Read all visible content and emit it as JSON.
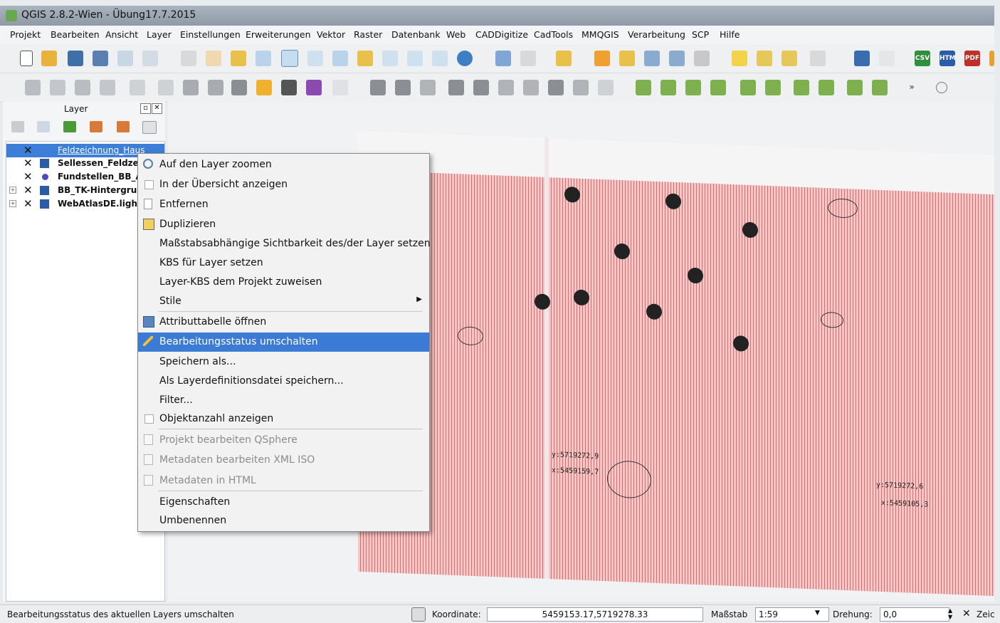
{
  "window": {
    "title": "QGIS 2.8.2-Wien - Übung17.7.2015"
  },
  "menubar": [
    "Projekt",
    "Bearbeiten",
    "Ansicht",
    "Layer",
    "Einstellungen",
    "Erweiterungen",
    "Vektor",
    "Raster",
    "Datenbank",
    "Web",
    "CADDigitize",
    "CadTools",
    "MMQGIS",
    "Verarbeitung",
    "SCP",
    "Hilfe"
  ],
  "toolbar_labels": {
    "csv": "CSV",
    "htm": "HTM",
    "pdf": "PDF"
  },
  "layer_panel": {
    "title": "Layer",
    "layers": [
      {
        "name": "Feldzeichnung_Haus",
        "checked": "✕",
        "selected": true
      },
      {
        "name": "Sellessen_Feldzei",
        "checked": "✕"
      },
      {
        "name": "Fundstellen_BB_A",
        "checked": "✕"
      },
      {
        "name": "BB_TK-Hintergrur",
        "checked": "✕"
      },
      {
        "name": "WebAtlasDE.light",
        "checked": "✕"
      }
    ]
  },
  "context_menu": {
    "items": [
      {
        "label": "Auf den Layer zoomen",
        "icon": "zoom-layer-icon"
      },
      {
        "label": "In der Übersicht anzeigen",
        "icon": "checkbox-icon"
      },
      {
        "label": "Entfernen",
        "icon": "remove-layer-icon"
      },
      {
        "label": "Duplizieren",
        "icon": "duplicate-icon"
      },
      {
        "label": "Maßstabsabhängige Sichtbarkeit des/der Layer setzen"
      },
      {
        "label": "KBS für Layer setzen"
      },
      {
        "label": "Layer-KBS dem Projekt zuweisen"
      },
      {
        "label": "Stile",
        "submenu": true
      },
      {
        "label": "Attributtabelle öffnen",
        "icon": "table-icon"
      },
      {
        "label": "Bearbeitungsstatus umschalten",
        "icon": "pencil-icon",
        "highlighted": true
      },
      {
        "label": "Speichern als..."
      },
      {
        "label": "Als Layerdefinitionsdatei speichern..."
      },
      {
        "label": "Filter..."
      },
      {
        "label": "Objektanzahl anzeigen",
        "icon": "checkbox-icon"
      },
      {
        "label": "Projekt bearbeiten QSphere",
        "disabled": true,
        "icon": "doc-icon"
      },
      {
        "label": "Metadaten bearbeiten XML ISO",
        "disabled": true,
        "icon": "doc-icon"
      },
      {
        "label": "Metadaten in HTML",
        "disabled": true,
        "icon": "doc-icon"
      },
      {
        "label": "Eigenschaften"
      },
      {
        "label": "Umbenennen"
      }
    ]
  },
  "map": {
    "annotations": [
      "y:5719272,9",
      "x:5459159,7",
      "y:5719272,6",
      "x:5459105,3"
    ]
  },
  "statusbar": {
    "message": "Bearbeitungsstatus des aktuellen Layers umschalten",
    "coord_label": "Koordinate:",
    "coord_value": "5459153.17,5719278.33",
    "scale_label": "Maßstab",
    "scale_value": "1:59",
    "rotation_label": "Drehung:",
    "rotation_value": "0,0",
    "render_label": "Zeic"
  },
  "colors": {
    "highlight": "#3b7bd6",
    "paper_line": "#d86c6c"
  }
}
